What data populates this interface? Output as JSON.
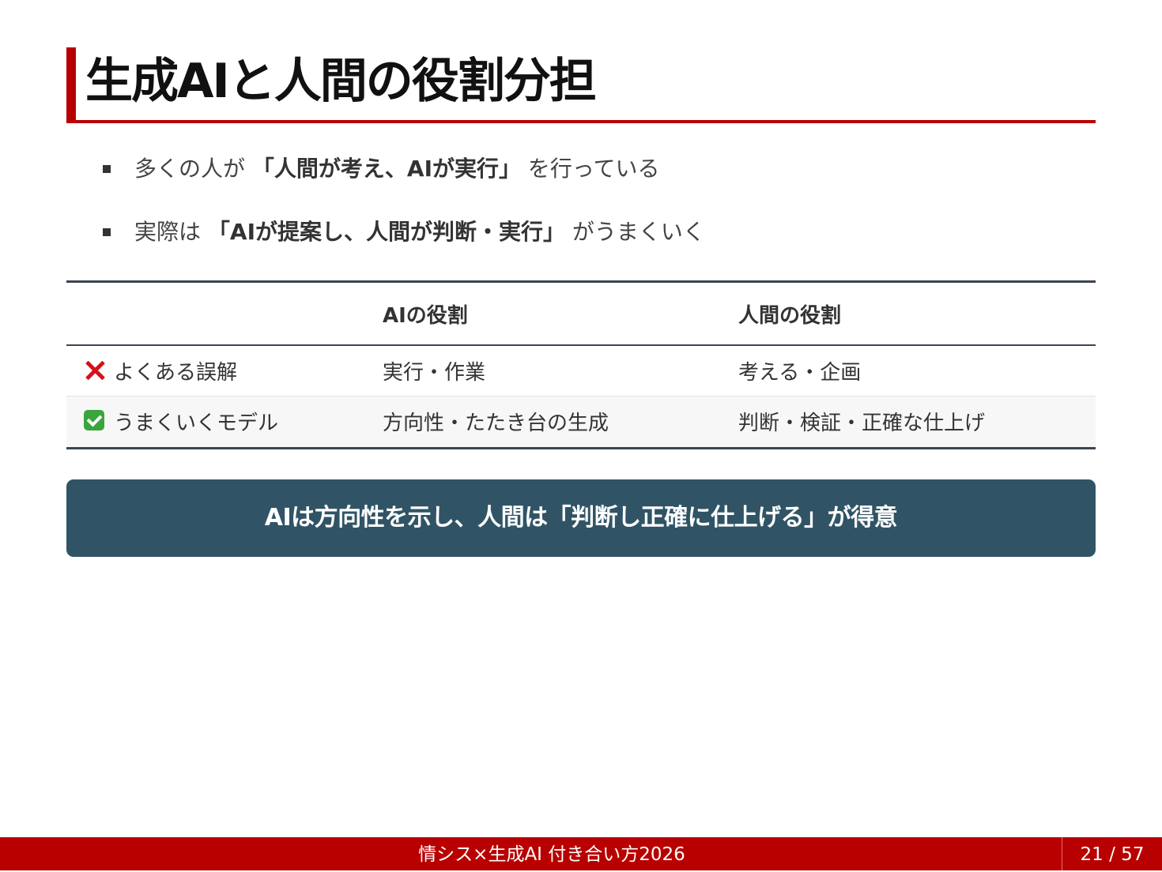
{
  "title": "生成AIと人間の役割分担",
  "bullets": [
    {
      "pre": "多くの人が ",
      "emph": "「人間が考え、AIが実行」",
      "post": " を行っている"
    },
    {
      "pre": "実際は ",
      "emph": "「AIが提案し、人間が判断・実行」",
      "post": " がうまくいく"
    }
  ],
  "table": {
    "headers": [
      "",
      "AIの役割",
      "人間の役割"
    ],
    "rows": [
      {
        "icon": "cross-mark-icon",
        "label": "よくある誤解",
        "ai": "実行・作業",
        "human": "考える・企画"
      },
      {
        "icon": "check-box-icon",
        "label": "うまくいくモデル",
        "ai": "方向性・たたき台の生成",
        "human": "判断・検証・正確な仕上げ"
      }
    ]
  },
  "callout": "AIは方向性を示し、人間は「判断し正確に仕上げる」が得意",
  "footer": {
    "title": "情シス×生成AI 付き合い方2026",
    "page": "21 / 57"
  },
  "colors": {
    "accent": "#b80000",
    "callout_bg": "#305466",
    "rule": "#3b4552",
    "cross": "#d6101a",
    "check": "#3aa53a"
  }
}
